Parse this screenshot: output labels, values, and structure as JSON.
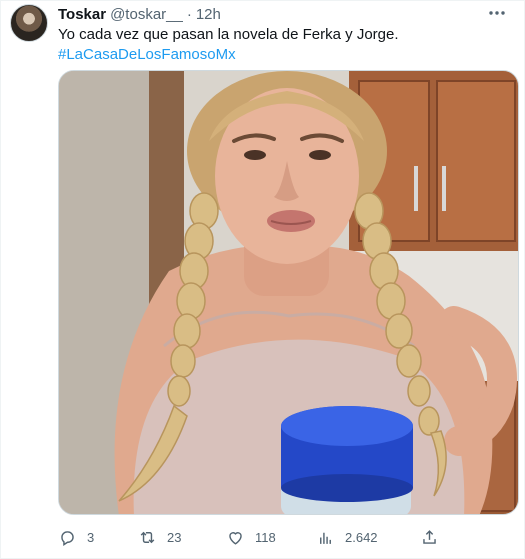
{
  "tweet": {
    "author_name": "Toskar",
    "handle": "@toskar__",
    "separator": "·",
    "time": "12h",
    "text": "Yo cada vez que pasan la novela de Ferka y Jorge.",
    "hashtag": "#LaCasaDeLosFamosoMx"
  },
  "actions": {
    "replies": "3",
    "retweets": "23",
    "likes": "118",
    "views": "2.642"
  },
  "icons": {
    "more": "more-horizontal-icon",
    "reply": "reply-bubble-icon",
    "retweet": "retweet-icon",
    "like": "heart-icon",
    "views": "views-bar-chart-icon",
    "share": "share-upload-icon"
  },
  "colors": {
    "text": "#0f1419",
    "secondary": "#536471",
    "link": "#1d9bf0",
    "border": "#cfd9de"
  }
}
